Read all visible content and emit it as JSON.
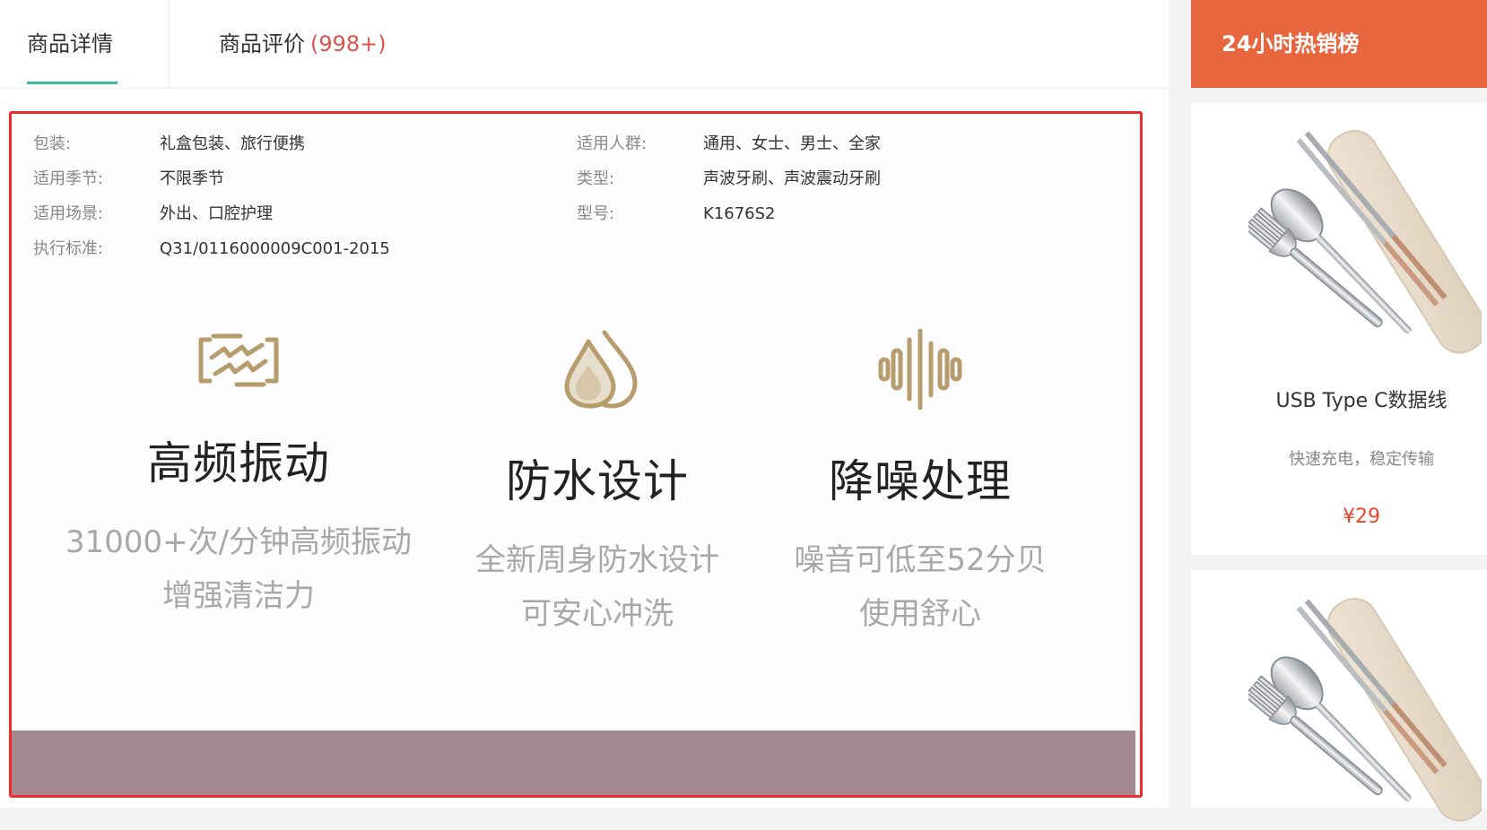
{
  "tabs": {
    "detail_label": "商品详情",
    "reviews_label": "商品评价",
    "reviews_count": "(998+)"
  },
  "specs": [
    {
      "key": "包装:",
      "value": "礼盒包装、旅行便携"
    },
    {
      "key": "适用季节:",
      "value": "不限季节"
    },
    {
      "key": "适用场景:",
      "value": "外出、口腔护理"
    },
    {
      "key": "执行标准:",
      "value": "Q31/0116000009C001-2015"
    },
    {
      "key": "适用人群:",
      "value": "通用、女士、男士、全家"
    },
    {
      "key": "类型:",
      "value": "声波牙刷、声波震动牙刷"
    },
    {
      "key": "型号:",
      "value": "K1676S2"
    }
  ],
  "features": [
    {
      "icon": "vibration-icon",
      "title": "高频振动",
      "line1": "31000+次/分钟高频振动",
      "line2": "增强清洁力"
    },
    {
      "icon": "water-drops-icon",
      "title": "防水设计",
      "line1": "全新周身防水设计",
      "line2": "可安心冲洗"
    },
    {
      "icon": "sound-wave-icon",
      "title": "降噪处理",
      "line1": "噪音可低至52分贝",
      "line2": "使用舒心"
    }
  ],
  "colors": {
    "accent_teal": "#3fb8a3",
    "sidebar_orange": "#e8663d",
    "price_red": "#e8452c",
    "frame_red": "#ef2b2b",
    "icon_gold": "#b79c6d"
  },
  "sidebar": {
    "title": "24小时热销榜",
    "products": [
      {
        "name": "USB Type C数据线",
        "desc": "快速充电，稳定传输",
        "price": "¥29",
        "image": "cutlery-set-image"
      },
      {
        "name": "",
        "desc": "",
        "price": "",
        "image": "cutlery-set-image"
      }
    ]
  }
}
